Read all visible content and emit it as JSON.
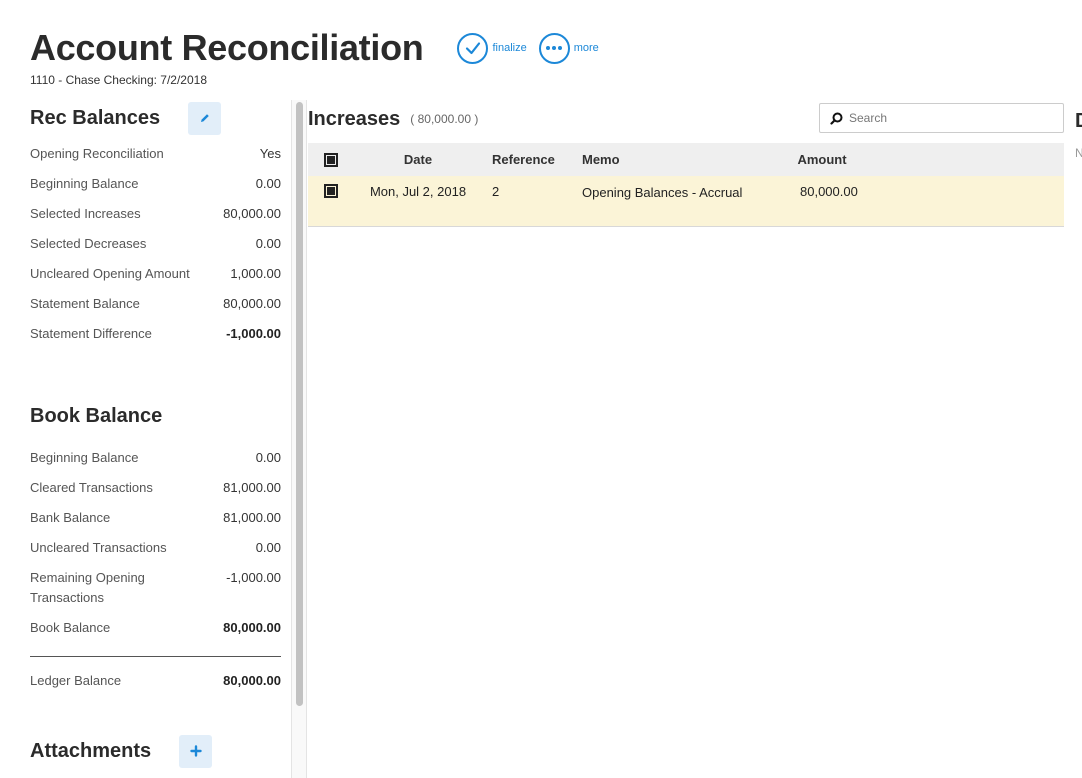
{
  "header": {
    "title": "Account Reconciliation",
    "subtitle": "1110 - Chase Checking: 7/2/2018",
    "finalize_label": "finalize",
    "more_label": "more"
  },
  "rec_balances": {
    "title": "Rec Balances",
    "rows": [
      {
        "label": "Opening Reconciliation",
        "value": "Yes"
      },
      {
        "label": "Beginning Balance",
        "value": "0.00"
      },
      {
        "label": "Selected Increases",
        "value": "80,000.00"
      },
      {
        "label": "Selected Decreases",
        "value": "0.00"
      },
      {
        "label": "Uncleared Opening Amount",
        "value": "1,000.00"
      },
      {
        "label": "Statement Balance",
        "value": "80,000.00"
      },
      {
        "label": "Statement Difference",
        "value": "-1,000.00"
      }
    ]
  },
  "book_balance": {
    "title": "Book Balance",
    "rows": [
      {
        "label": "Beginning Balance",
        "value": "0.00"
      },
      {
        "label": "Cleared Transactions",
        "value": "81,000.00"
      },
      {
        "label": "Bank Balance",
        "value": "81,000.00"
      },
      {
        "label": "Uncleared Transactions",
        "value": "0.00"
      },
      {
        "label": "Remaining Opening Transactions",
        "value": "-1,000.00"
      },
      {
        "label": "Book Balance",
        "value": "80,000.00"
      }
    ],
    "ledger": {
      "label": "Ledger Balance",
      "value": "80,000.00"
    }
  },
  "attachments": {
    "title": "Attachments"
  },
  "increases": {
    "title": "Increases",
    "count": "( 80,000.00 )",
    "search_placeholder": "Search",
    "columns": {
      "date": "Date",
      "reference": "Reference",
      "memo": "Memo",
      "amount": "Amount"
    },
    "rows": [
      {
        "date": "Mon, Jul 2, 2018",
        "reference": "2",
        "memo": "Opening Balances - Accrual",
        "amount": "80,000.00"
      }
    ]
  },
  "right_peek": {
    "title": "D",
    "sub": "N"
  },
  "colors": {
    "accent": "#1c88d8",
    "selected_row": "#fbf4d7",
    "header_bg": "#efefef"
  }
}
